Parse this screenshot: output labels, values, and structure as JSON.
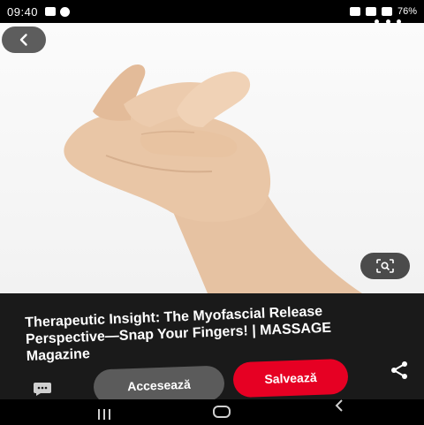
{
  "status_bar": {
    "time": "09:40",
    "battery": "76%"
  },
  "pin": {
    "title": "Therapeutic Insight: The Myofascial Release Perspective—Snap Your Fingers! | MASSAGE Magazine"
  },
  "actions": {
    "visit_label": "Accesează",
    "save_label": "Salvează"
  },
  "icons": {
    "back": "chevron-left-icon",
    "more": "more-horizontal-icon",
    "lens": "visual-search-icon",
    "comment": "comment-icon",
    "share": "share-icon",
    "nav_recents": "recents-icon",
    "nav_home": "home-icon",
    "nav_back": "nav-back-icon"
  },
  "colors": {
    "save": "#e60023",
    "visit": "#5b5b5b",
    "panel": "#1a1a1a"
  }
}
